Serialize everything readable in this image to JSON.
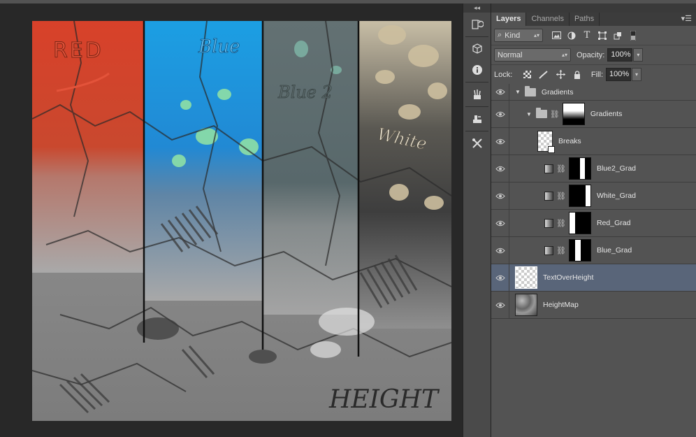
{
  "panel": {
    "tabs": [
      "Layers",
      "Channels",
      "Paths"
    ],
    "active_tab": "Layers",
    "filter": {
      "label": "Kind"
    },
    "blend_mode": "Normal",
    "opacity_label": "Opacity:",
    "opacity": "100%",
    "lock_label": "Lock:",
    "fill_label": "Fill:",
    "fill": "100%"
  },
  "canvas": {
    "labels": [
      "RED",
      "Blue",
      "Blue 2",
      "White",
      "HEIGHT"
    ]
  },
  "layers": [
    {
      "name": "Gradients",
      "kind": "group",
      "expanded": true
    },
    {
      "name": "Gradients",
      "kind": "group-with-mask",
      "expanded": true
    },
    {
      "name": "Breaks",
      "kind": "pixel"
    },
    {
      "name": "Blue2_Grad",
      "kind": "adjustment"
    },
    {
      "name": "White_Grad",
      "kind": "adjustment"
    },
    {
      "name": "Red_Grad",
      "kind": "adjustment"
    },
    {
      "name": "Blue_Grad",
      "kind": "adjustment"
    },
    {
      "name": "TextOverHeight",
      "kind": "pixel",
      "selected": true
    },
    {
      "name": "HeightMap",
      "kind": "pixel"
    }
  ],
  "colors": {
    "panel_bg": "#535353",
    "selected_row": "#596579",
    "red_strip": "#d9432a",
    "blue_strip": "#1f8fd8",
    "blue2_strip": "#5f6f70",
    "white_strip": "#c9bfa7"
  }
}
